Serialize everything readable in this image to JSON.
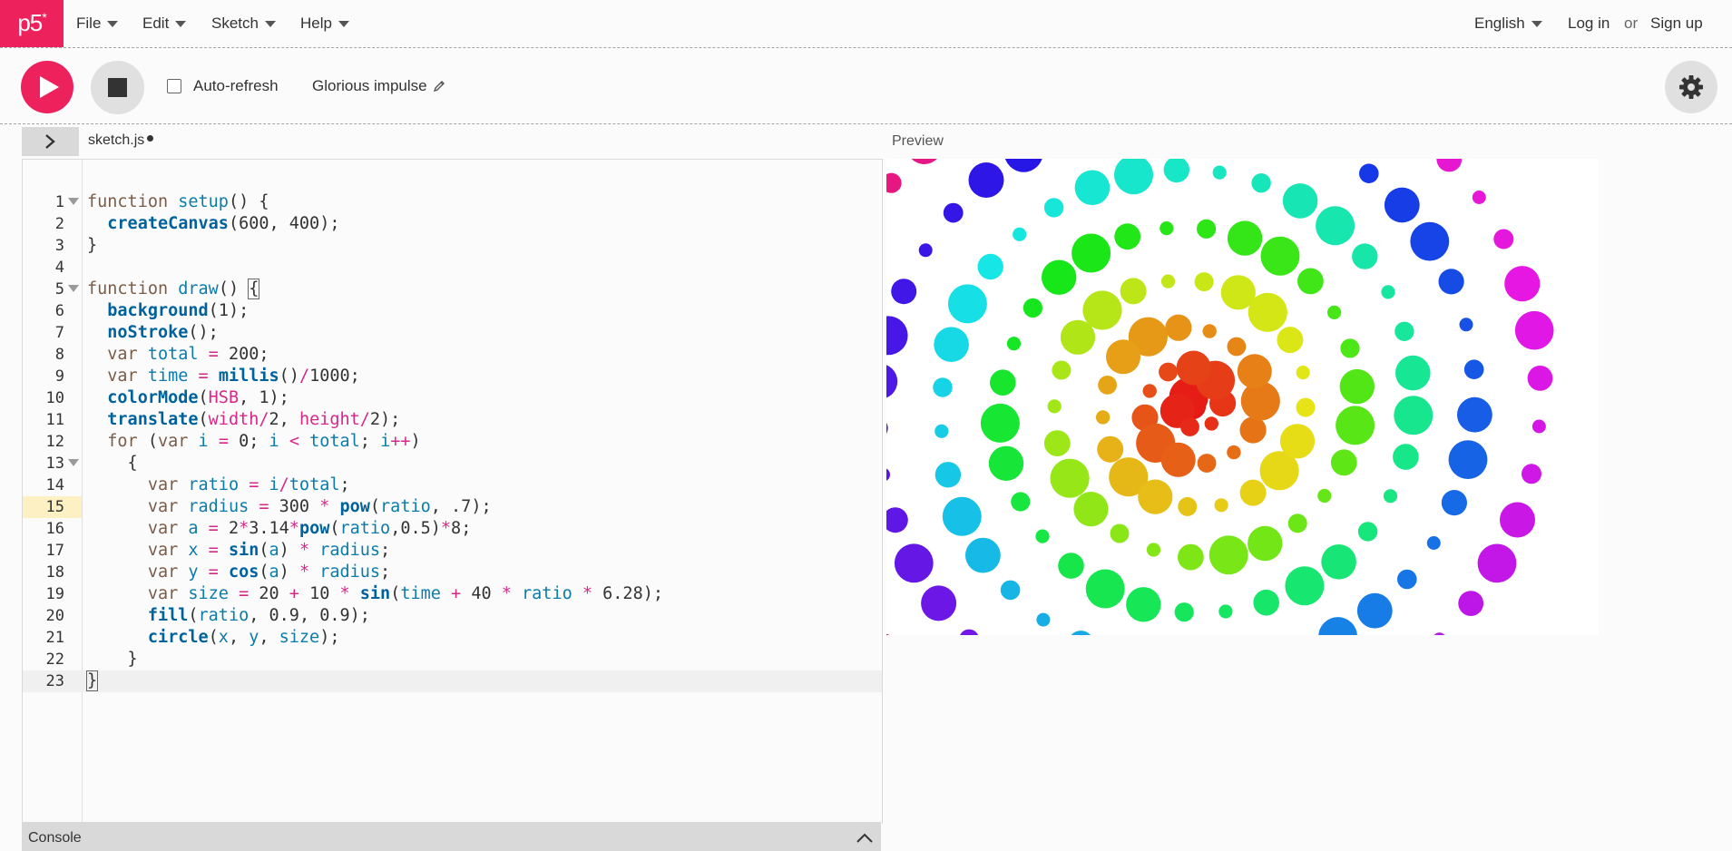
{
  "app": {
    "logo": "p5",
    "logo_mark": "*"
  },
  "nav": {
    "menus": [
      "File",
      "Edit",
      "Sketch",
      "Help"
    ],
    "language": "English",
    "login": "Log in",
    "or": "or",
    "signup": "Sign up"
  },
  "toolbar": {
    "autorefresh_label": "Auto-refresh",
    "autorefresh_checked": false,
    "project_name": "Glorious impulse"
  },
  "editor": {
    "file_name": "sketch.js",
    "unsaved": true,
    "highlighted_line": 15,
    "lines": [
      "function setup() {",
      "  createCanvas(600, 400);",
      "}",
      "",
      "function draw() {",
      "  background(1);",
      "  noStroke();",
      "  var total = 200;",
      "  var time = millis()/1000;",
      "  colorMode(HSB, 1);",
      "  translate(width/2, height/2);",
      "  for (var i = 0; i < total; i++)",
      "    {",
      "      var ratio = i/total;",
      "      var radius = 300 * pow(ratio, .7);",
      "      var a = 2*3.14*pow(ratio,0.5)*8;",
      "      var x = sin(a) * radius;",
      "      var y = cos(a) * radius;",
      "      var size = 20 + 10 * sin(time + 40 * ratio * 6.28);",
      "      fill(ratio, 0.9, 0.9);",
      "      circle(x, y, size);",
      "    }",
      "}"
    ],
    "foldable_lines": [
      1,
      5,
      13
    ]
  },
  "preview": {
    "label": "Preview",
    "sketch": {
      "total": 200,
      "time": 0
    }
  },
  "console": {
    "label": "Console"
  },
  "colors": {
    "accent": "#ed225d",
    "button_grey": "#e0e0e0",
    "bar_grey": "#d9d9d9"
  }
}
